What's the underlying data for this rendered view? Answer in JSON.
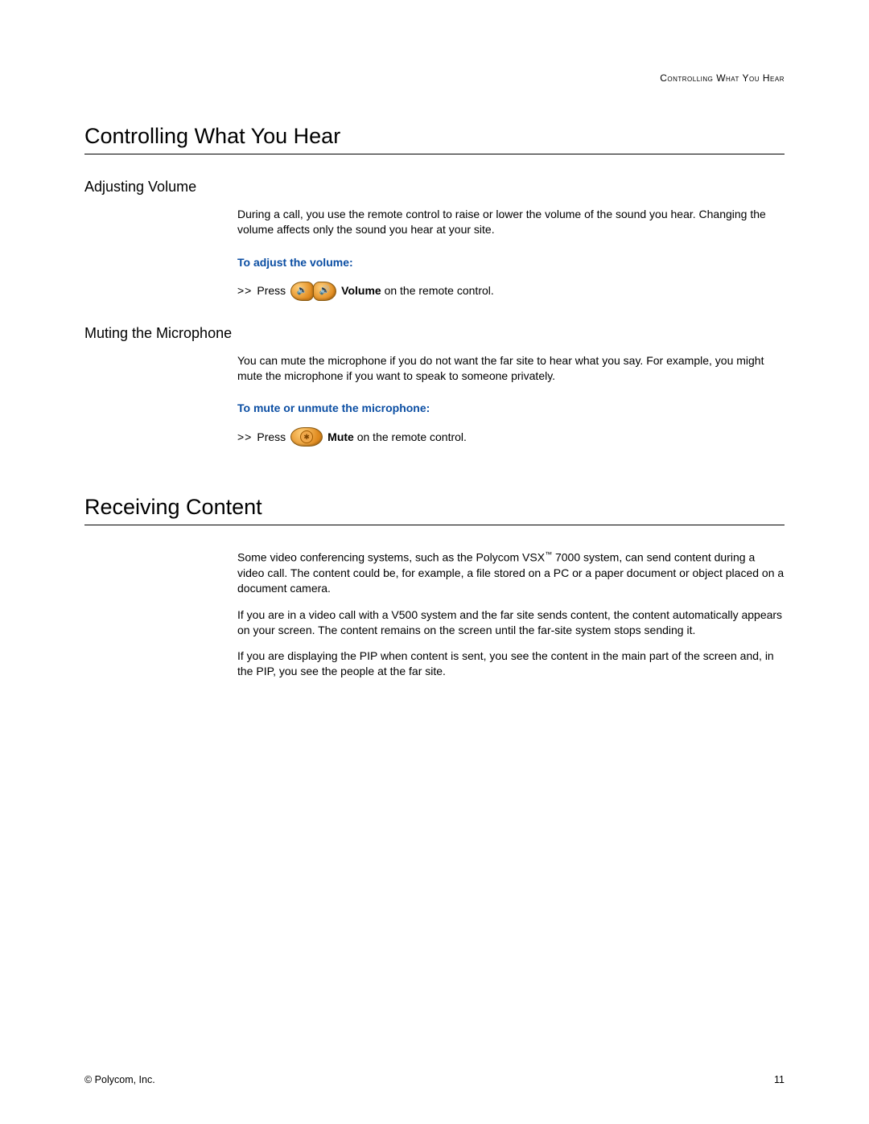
{
  "running_header": "Controlling What You Hear",
  "section1": {
    "title": "Controlling What You Hear",
    "sub1": {
      "heading": "Adjusting Volume",
      "para": "During a call, you use the remote control to raise or lower the volume of the sound you hear. Changing the volume affects only the sound you hear at your site.",
      "instr_heading": "To adjust the volume:",
      "arrows": ">>",
      "press": "Press",
      "bold_label": "Volume",
      "trail": " on the remote control."
    },
    "sub2": {
      "heading": "Muting the Microphone",
      "para": "You can mute the microphone if you do not want the far site to hear what you say. For example, you might mute the microphone if you want to speak to someone privately.",
      "instr_heading": "To mute or unmute the microphone:",
      "arrows": ">>",
      "press": "Press",
      "bold_label": "Mute",
      "trail": " on the remote control."
    }
  },
  "section2": {
    "title": "Receiving Content",
    "para1a": "Some video conferencing systems, such as the Polycom VSX",
    "para1_tm": "™",
    "para1b": " 7000 system, can send content during a video call. The content could be, for example, a file stored on a PC or a paper document or object placed on a document camera.",
    "para2": "If you are in a video call with a V500 system and the far site sends content, the content automatically appears on your screen. The content remains on the screen until the far-site system stops sending it.",
    "para3": "If you are displaying the PIP when content is sent, you see the content in the main part of the screen and, in the PIP, you see the people at the far site."
  },
  "footer": {
    "copyright": "© Polycom, Inc.",
    "page_number": "11"
  }
}
